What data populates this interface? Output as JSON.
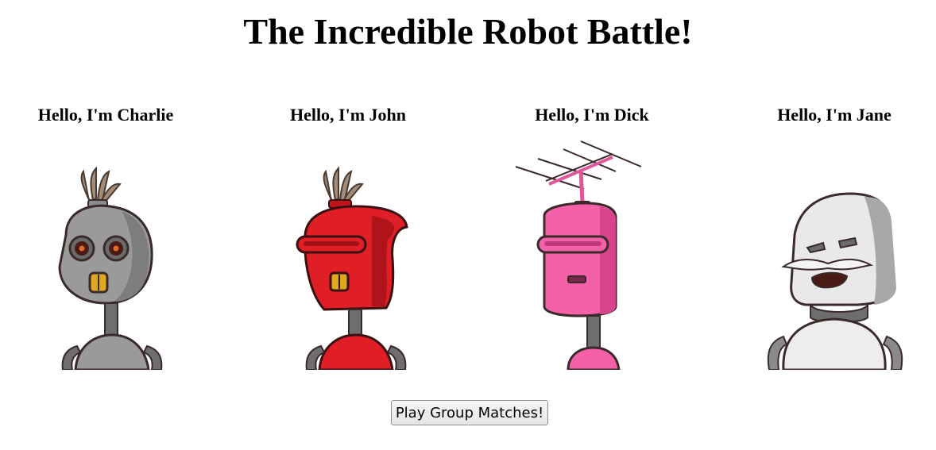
{
  "page": {
    "title": "The Incredible Robot Battle!"
  },
  "robots": [
    {
      "greeting": "Hello, I'm Charlie",
      "color": "#9a9a9a"
    },
    {
      "greeting": "Hello, I'm John",
      "color": "#e01e25"
    },
    {
      "greeting": "Hello, I'm Dick",
      "color": "#f561a8"
    },
    {
      "greeting": "Hello, I'm Jane",
      "color": "#e9e9e9"
    }
  ],
  "controls": {
    "play_label": "Play Group Matches!"
  }
}
